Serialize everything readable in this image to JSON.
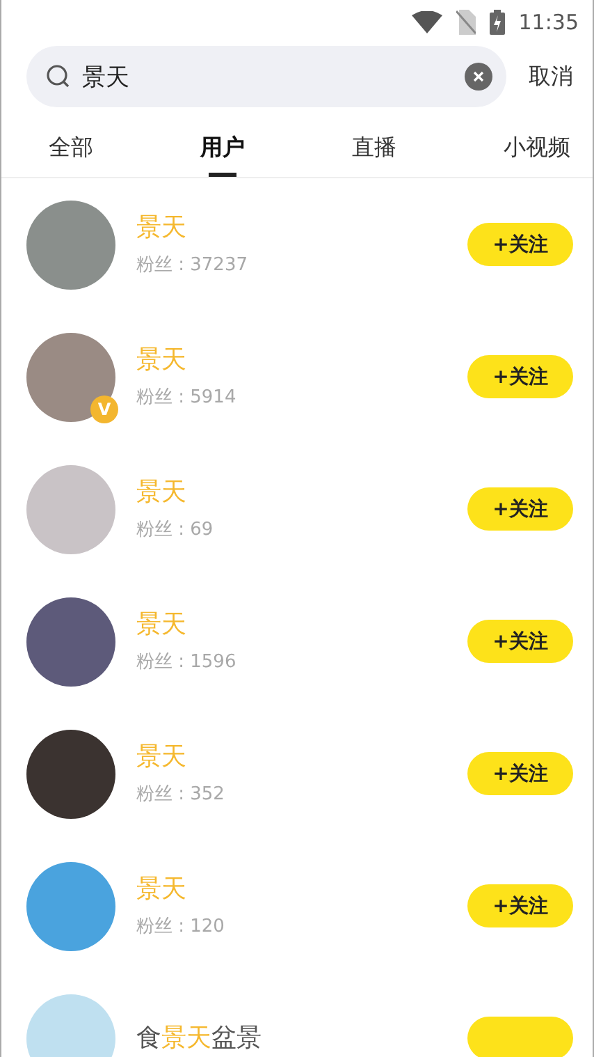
{
  "status_bar": {
    "time": "11:35"
  },
  "search": {
    "value": "景天",
    "cancel": "取消"
  },
  "tabs": [
    {
      "label": "全部",
      "selected": false
    },
    {
      "label": "用户",
      "selected": true
    },
    {
      "label": "直播",
      "selected": false
    },
    {
      "label": "小视频",
      "selected": false
    }
  ],
  "verified_mark": "V",
  "users": [
    {
      "name_parts": [
        {
          "text": "景天",
          "highlight": true
        }
      ],
      "fans": "粉丝 : 37237",
      "verified": false,
      "follow": "+关注"
    },
    {
      "name_parts": [
        {
          "text": "景天",
          "highlight": true
        }
      ],
      "fans": "粉丝 : 5914",
      "verified": true,
      "follow": "+关注"
    },
    {
      "name_parts": [
        {
          "text": "景天",
          "highlight": true
        }
      ],
      "fans": "粉丝 : 69",
      "verified": false,
      "follow": "+关注"
    },
    {
      "name_parts": [
        {
          "text": "景天",
          "highlight": true
        }
      ],
      "fans": "粉丝 : 1596",
      "verified": false,
      "follow": "+关注"
    },
    {
      "name_parts": [
        {
          "text": "景天",
          "highlight": true
        }
      ],
      "fans": "粉丝 : 352",
      "verified": false,
      "follow": "+关注"
    },
    {
      "name_parts": [
        {
          "text": "景天",
          "highlight": true
        }
      ],
      "fans": "粉丝 : 120",
      "verified": false,
      "follow": "+关注"
    },
    {
      "name_parts": [
        {
          "text": "食",
          "highlight": false
        },
        {
          "text": "景天",
          "highlight": true
        },
        {
          "text": "盆景",
          "highlight": false
        }
      ],
      "verified": false
    }
  ]
}
